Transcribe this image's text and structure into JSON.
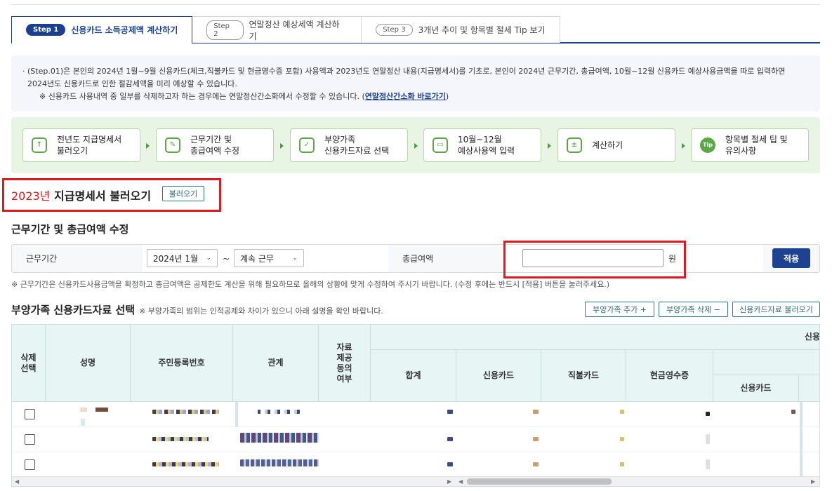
{
  "tabs": [
    {
      "step": "Step 1",
      "label": "신용카드 소득공제액 계산하기"
    },
    {
      "step": "Step 2",
      "label": "연말정산 예상세액 계산하기"
    },
    {
      "step": "Step 3",
      "label": "3개년 추이 및 항목별 절세 Tip 보기"
    }
  ],
  "notice": {
    "line1": "· (Step.01)은 본인의 2024년 1월~9월 신용카드(체크,직불카드 및 현금영수증 포함) 사용액과 2023년도 연말정산 내용(지급명세서)를 기초로, 본인이 2024년 근무기간, 총급여액, 10월~12월 신용카드 예상사용금액을 따로 입력하면",
    "line2": "2024년도 신용카드로 인한 절감세액을 미리 예상할 수 있습니다.",
    "line3_prefix": "※ 신용카드 사용내역 중 일부를 삭제하고자 하는 경우에는 연말정산간소화에서 수정할 수 있습니다. (",
    "link": "연말정산간소화 바로가기",
    "line3_suffix": ")"
  },
  "flow": [
    {
      "l1": "전년도 지급명세서",
      "l2": "불러오기",
      "icon": "↑"
    },
    {
      "l1": "근무기간 및",
      "l2": "총급여액 수정",
      "icon": "✎"
    },
    {
      "l1": "부양가족",
      "l2": "신용카드자료 선택",
      "icon": "✓"
    },
    {
      "l1": "10월~12월",
      "l2": "예상사용액 입력",
      "icon": "▭"
    },
    {
      "l1": "계산하기",
      "l2": "",
      "icon": "±"
    },
    {
      "l1": "항목별 절세 팁 및",
      "l2": "유의사항",
      "icon": "Tip"
    }
  ],
  "load_section": {
    "year": "2023년",
    "title": " 지급명세서 불러오기",
    "button": "불러오기"
  },
  "period_section": {
    "title": "근무기간 및 총급여액 수정",
    "period_label": "근무기간",
    "start_value": "2024년 1월",
    "tilde": "~",
    "end_value": "계속 근무",
    "salary_label": "총급여액",
    "salary_value": "",
    "unit": "원",
    "apply": "적용",
    "note": "※ 근무기간은 신용카드사용금액을 확정하고 총급여액은 공제한도 계산을 위해 필요하므로 올해의 상황에 맞게 수정하여 주시기 바랍니다. (수정 후에는 반드시 [적용] 버튼을 눌러주세요.)"
  },
  "dependents": {
    "title": "부양가족 신용카드자료 선택",
    "subtitle": "※ 부양가족의 범위는 인적공제와 차이가 있으니 아래 설명을 확인 바랍니다.",
    "add": "부양가족 추가 +",
    "delete": "부양가족 삭제 −",
    "load": "신용카드자료 불러오기",
    "headers": {
      "delete": "삭제\n선택",
      "name": "성명",
      "rrn": "주민등록번호",
      "relation": "관계",
      "consent": "자료\n제공\n동의\n여부",
      "group": "신용",
      "total": "합계",
      "credit": "신용카드",
      "debit": "직불카드",
      "cash": "현금영수증",
      "sub_credit": "신용카드"
    }
  },
  "colors": {
    "accent": "#1a3f8f",
    "highlight": "#e0191e",
    "flow_bg": "#e9f5e4",
    "header_bg": "#e8f5f5"
  }
}
